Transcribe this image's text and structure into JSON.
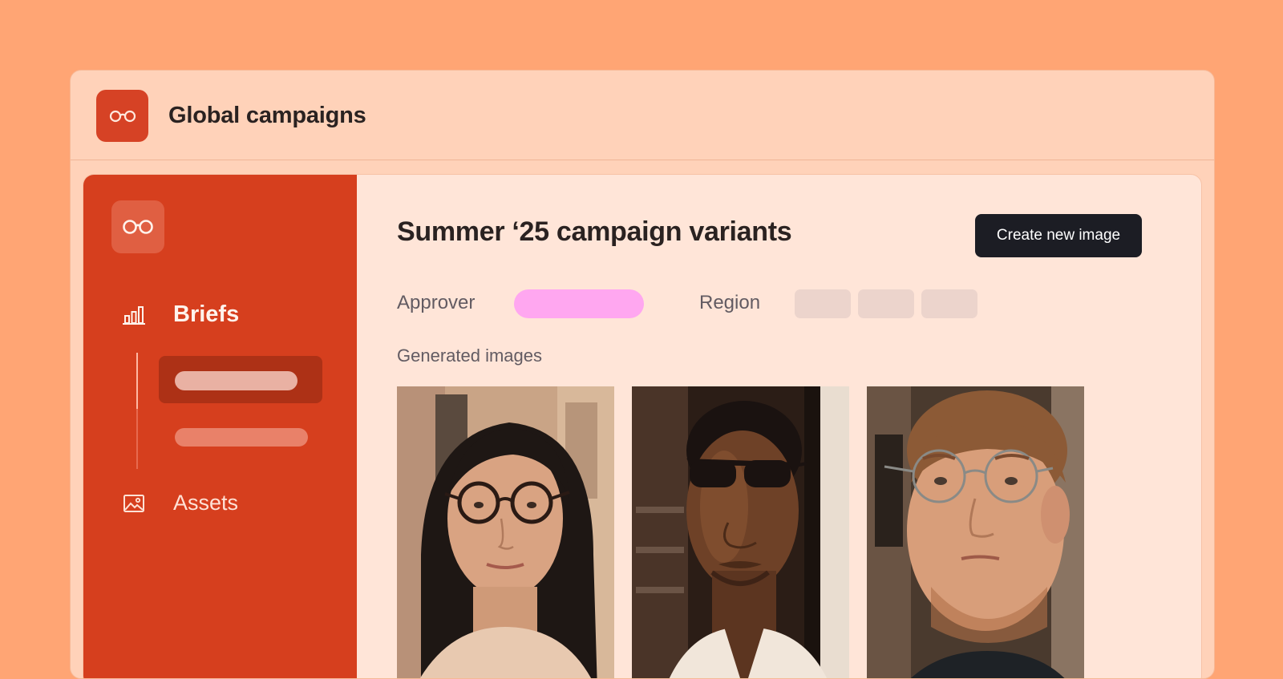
{
  "app": {
    "title": "Global campaigns",
    "logo_icon": "glasses-icon",
    "accent": "#d63f1e",
    "background": "#ffa574"
  },
  "sidebar": {
    "logo_icon": "glasses-icon",
    "items": [
      {
        "label": "Briefs",
        "icon": "bar-chart-icon",
        "active": true
      },
      {
        "label": "Assets",
        "icon": "image-icon",
        "active": false
      }
    ]
  },
  "main": {
    "title": "Summer ‘25 campaign variants",
    "create_button": "Create new image",
    "fields": {
      "approver_label": "Approver",
      "region_label": "Region"
    },
    "section_label": "Generated images",
    "images": [
      {
        "icon": "portrait-woman-round-glasses"
      },
      {
        "icon": "portrait-man-sunglasses"
      },
      {
        "icon": "portrait-man-wire-glasses"
      }
    ]
  }
}
